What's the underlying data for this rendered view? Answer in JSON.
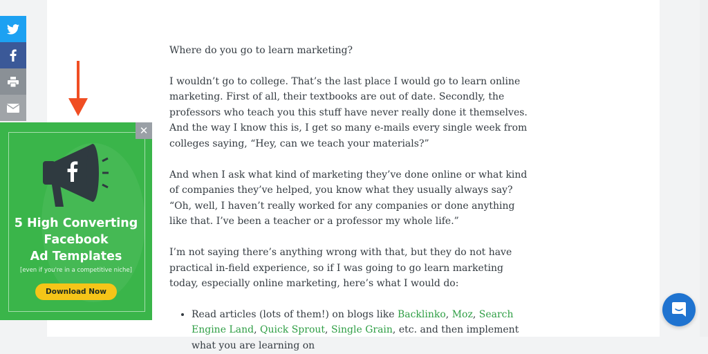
{
  "share": {
    "twitter_icon": "twitter-icon",
    "facebook_icon": "facebook-icon",
    "print_icon": "print-icon",
    "email_icon": "email-icon"
  },
  "promo": {
    "close_label": "✕",
    "headline_line1": "5 High Converting",
    "headline_line2": "Facebook",
    "headline_line3": "Ad Templates",
    "subtext": "[even if you're in a competitive niche]",
    "cta_label": "Download Now",
    "colors": {
      "background": "#3ab54a",
      "button": "#f5c518"
    }
  },
  "article": {
    "p1": "Where do you go to learn marketing?",
    "p2": "I wouldn’t go to college. That’s the last place I would go to learn online marketing. First of all, their textbooks are out of date. Secondly, the professors who teach you this stuff have never really done it themselves. And the way I know this is, I get so many e-mails every single week from colleges saying, “Hey, can we teach your materials?”",
    "p3": "And when I ask what kind of marketing they’ve done online or what kind of companies they’ve helped, you know what they usually always say? “Oh, well, I haven’t really worked for any companies or done anything like that. I’ve been a teacher or a professor my whole life.”",
    "p4": "I’m not saying there’s anything wrong with that, but they do not have practical in-field experience, so if I was going to go learn marketing today, especially online marketing, here’s what I would do:",
    "li1_prefix": "Read articles (lots of them!) on blogs like ",
    "links": [
      "Backlinko",
      "Moz",
      "Search Engine Land",
      "Quick Sprout",
      "Single Grain"
    ],
    "sep1": ", ",
    "sep2": ", ",
    "sep3": ",",
    "sep4": ", ",
    "li1_suffix": ", etc. and then implement what you are learning on"
  },
  "chat": {
    "icon": "chat-icon"
  }
}
